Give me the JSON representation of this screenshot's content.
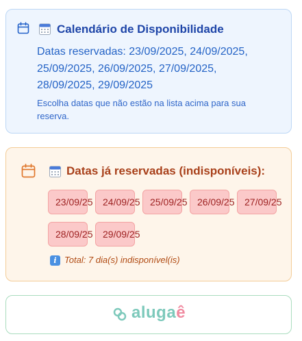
{
  "availability": {
    "title": "Calendário de Disponibilidade",
    "dates_text": "Datas reservadas: 23/09/2025, 24/09/2025, 25/09/2025, 26/09/2025, 27/09/2025, 28/09/2025, 29/09/2025",
    "note": "Escolha datas que não estão na lista acima para sua reserva.",
    "icons": [
      "calendar-outline-icon",
      "calendar-emoji-icon"
    ]
  },
  "reserved": {
    "title": "Datas já reservadas (indisponíveis):",
    "dates": [
      "23/09/25",
      "24/09/25",
      "25/09/25",
      "26/09/25",
      "27/09/25",
      "28/09/25",
      "29/09/25"
    ],
    "total": "Total: 7 dia(s) indisponível(is)",
    "icons": [
      "calendar-outline-icon",
      "calendar-emoji-icon",
      "info-icon"
    ]
  },
  "brand": {
    "logo_prefix": "aluga",
    "logo_accent": "ê",
    "colors": {
      "primary": "#7dc9bb",
      "accent": "#f08aa0"
    }
  },
  "colors": {
    "info_bg": "#eef5fe",
    "info_text": "#1e45a8",
    "warn_bg": "#fef5ea",
    "warn_text": "#a8401a",
    "chip_bg": "#fbc9c9",
    "chip_text": "#9c1f1f"
  }
}
